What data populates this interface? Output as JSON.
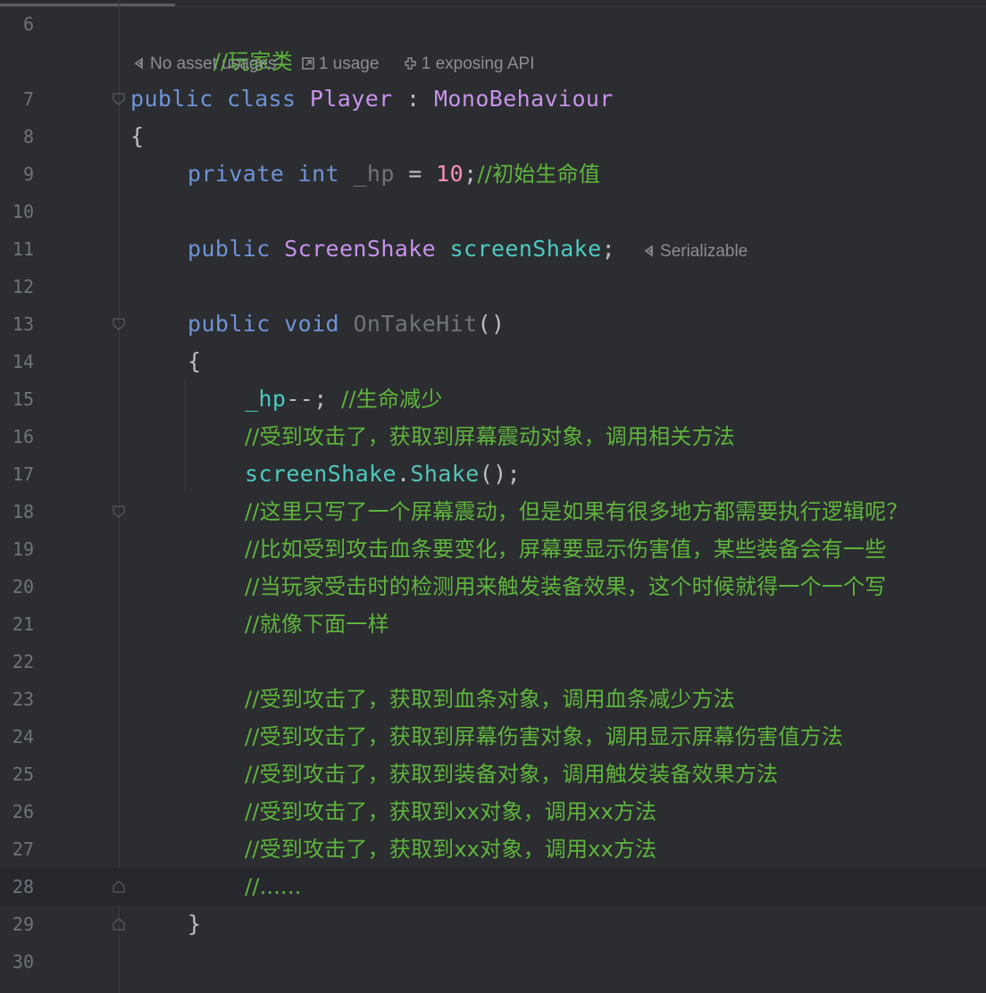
{
  "editor": {
    "colors": {
      "background": "#2b2d30",
      "keyword": "#6f92d6",
      "class_name": "#c792ea",
      "field": "#4ec9c0",
      "number": "#f78fb3",
      "comment": "#5fb43d",
      "line_number": "#6f737a"
    },
    "hints": {
      "asset_usages": "No asset usages",
      "usage": "1 usage",
      "exposing_api": "1 exposing API",
      "serializable": "Serializable"
    },
    "lines": {
      "l6": {
        "num": "6",
        "comment": "//玩家类"
      },
      "l7": {
        "num": "7",
        "kw1": "public",
        "kw2": "class",
        "name": "Player",
        "colon": " : ",
        "base": "MonoBehaviour"
      },
      "l8": {
        "num": "8",
        "text": "{"
      },
      "l9": {
        "num": "9",
        "kw1": "private",
        "kw2": "int",
        "field": "_hp",
        "eq": " = ",
        "value": "10",
        "semi": ";",
        "comment": "//初始生命值"
      },
      "l10": {
        "num": "10"
      },
      "l11": {
        "num": "11",
        "kw": "public",
        "type": "ScreenShake",
        "field": "screenShake",
        "semi": ";"
      },
      "l12": {
        "num": "12"
      },
      "l13": {
        "num": "13",
        "kw1": "public",
        "kw2": "void",
        "method": "OnTakeHit",
        "parens": "()"
      },
      "l14": {
        "num": "14",
        "text": "{"
      },
      "l15": {
        "num": "15",
        "field": "_hp",
        "op": "--; ",
        "comment": "//生命减少"
      },
      "l16": {
        "num": "16",
        "comment": "//受到攻击了，获取到屏幕震动对象，调用相关方法"
      },
      "l17": {
        "num": "17",
        "field": "screenShake",
        "dot": ".",
        "method": "Shake",
        "rest": "();"
      },
      "l18": {
        "num": "18",
        "comment": "//这里只写了一个屏幕震动，但是如果有很多地方都需要执行逻辑呢？"
      },
      "l19": {
        "num": "19",
        "comment": "//比如受到攻击血条要变化，屏幕要显示伤害值，某些装备会有一些"
      },
      "l20": {
        "num": "20",
        "comment": "//当玩家受击时的检测用来触发装备效果，这个时候就得一个一个写"
      },
      "l21": {
        "num": "21",
        "comment": "//就像下面一样"
      },
      "l22": {
        "num": "22"
      },
      "l23": {
        "num": "23",
        "comment": "//受到攻击了，获取到血条对象，调用血条减少方法"
      },
      "l24": {
        "num": "24",
        "comment": "//受到攻击了，获取到屏幕伤害对象，调用显示屏幕伤害值方法"
      },
      "l25": {
        "num": "25",
        "comment": "//受到攻击了，获取到装备对象，调用触发装备效果方法"
      },
      "l26": {
        "num": "26",
        "comment": "//受到攻击了，获取到xx对象，调用xx方法"
      },
      "l27": {
        "num": "27",
        "comment": "//受到攻击了，获取到xx对象，调用xx方法"
      },
      "l28": {
        "num": "28",
        "comment": "//......"
      },
      "l29": {
        "num": "29",
        "text": "}"
      },
      "l30": {
        "num": "30"
      }
    }
  }
}
